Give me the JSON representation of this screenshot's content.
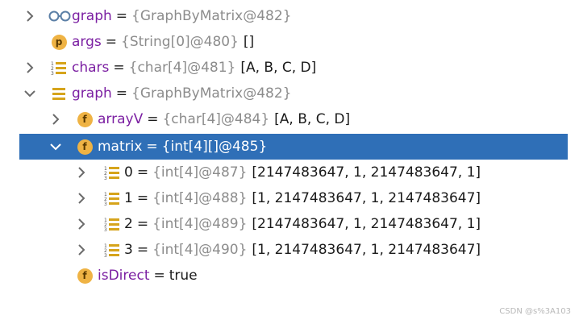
{
  "colors": {
    "selection": "#2f6fb7",
    "field_badge": "#efb344",
    "list_icon": "#d6a41b",
    "glasses_icon": "#5b7fa6"
  },
  "rows": [
    {
      "name": "graph",
      "eq": "=",
      "type": "{GraphByMatrix@482}",
      "value": "",
      "icon": "watch-glasses-icon",
      "chevron": "right"
    },
    {
      "name": "args",
      "eq": "=",
      "type": "{String[0]@480}",
      "value": "[]",
      "icon": "parameter-icon",
      "chevron": "none"
    },
    {
      "name": "chars",
      "eq": "=",
      "type": "{char[4]@481}",
      "value": "[A, B, C, D]",
      "icon": "array-icon",
      "chevron": "right"
    },
    {
      "name": "graph",
      "eq": "=",
      "type": "{GraphByMatrix@482}",
      "value": "",
      "icon": "object-icon",
      "chevron": "down"
    },
    {
      "name": "arrayV",
      "eq": "=",
      "type": "{char[4]@484}",
      "value": "[A, B, C, D]",
      "icon": "field-icon",
      "chevron": "right"
    },
    {
      "name": "matrix",
      "eq": "=",
      "type": "{int[4][]@485}",
      "value": "",
      "icon": "field-icon",
      "chevron": "down"
    },
    {
      "name": "0",
      "eq": "=",
      "type": "{int[4]@487}",
      "value": "[2147483647, 1, 2147483647, 1]",
      "icon": "array-icon",
      "chevron": "right"
    },
    {
      "name": "1",
      "eq": "=",
      "type": "{int[4]@488}",
      "value": "[1, 2147483647, 1, 2147483647]",
      "icon": "array-icon",
      "chevron": "right"
    },
    {
      "name": "2",
      "eq": "=",
      "type": "{int[4]@489}",
      "value": "[2147483647, 1, 2147483647, 1]",
      "icon": "array-icon",
      "chevron": "right"
    },
    {
      "name": "3",
      "eq": "=",
      "type": "{int[4]@490}",
      "value": "[1, 2147483647, 1, 2147483647]",
      "icon": "array-icon",
      "chevron": "right"
    },
    {
      "name": "isDirect",
      "eq": "=",
      "type": "",
      "value": "true",
      "icon": "field-icon",
      "chevron": "none"
    }
  ],
  "badges": {
    "parameter": "p",
    "field": "f"
  },
  "watermark": "CSDN @s%3A103"
}
